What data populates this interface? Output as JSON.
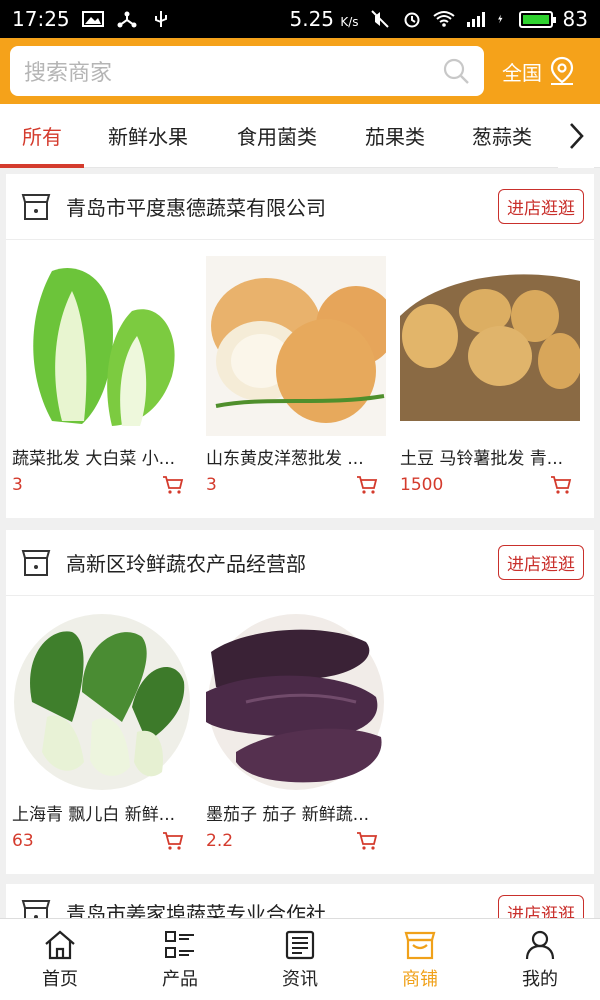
{
  "status_bar": {
    "time": "17:25",
    "speed": "5.25",
    "speed_unit": "K/s",
    "battery": "83"
  },
  "search": {
    "placeholder": "搜索商家"
  },
  "region": {
    "label": "全国"
  },
  "tabs": [
    {
      "label": "所有",
      "active": true
    },
    {
      "label": "新鲜水果"
    },
    {
      "label": "食用菌类"
    },
    {
      "label": "茄果类"
    },
    {
      "label": "葱蒜类"
    }
  ],
  "shops": [
    {
      "name": "青岛市平度惠德蔬菜有限公司",
      "button": "进店逛逛",
      "products": [
        {
          "name": "蔬菜批发 大白菜 小...",
          "price": "3"
        },
        {
          "name": "山东黄皮洋葱批发 ...",
          "price": "3"
        },
        {
          "name": "土豆 马铃薯批发 青...",
          "price": "1500"
        }
      ]
    },
    {
      "name": "高新区玲鲜蔬农产品经营部",
      "button": "进店逛逛",
      "products": [
        {
          "name": "上海青 飘儿白 新鲜...",
          "price": "63"
        },
        {
          "name": "墨茄子 茄子 新鲜蔬...",
          "price": "2.2"
        }
      ]
    },
    {
      "name": "青岛市姜家埠蔬菜专业合作社",
      "button": "进店逛逛",
      "products": []
    }
  ],
  "bottom_nav": [
    {
      "label": "首页",
      "icon": "home-icon"
    },
    {
      "label": "产品",
      "icon": "product-list-icon"
    },
    {
      "label": "资讯",
      "icon": "news-icon"
    },
    {
      "label": "商铺",
      "icon": "shop-icon",
      "active": true
    },
    {
      "label": "我的",
      "icon": "user-icon"
    }
  ],
  "colors": {
    "header": "#f5a21a",
    "accent": "#d43b2d",
    "nav_active": "#f0a11a"
  }
}
